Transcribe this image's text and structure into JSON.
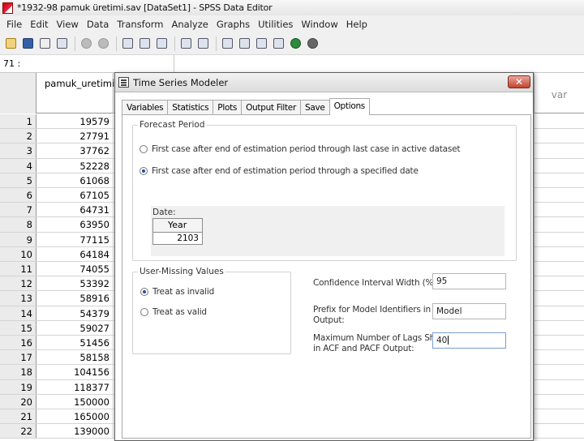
{
  "window": {
    "title": "*1932-98 pamuk üretimi.sav [DataSet1] - SPSS Data Editor"
  },
  "menubar": [
    "File",
    "Edit",
    "View",
    "Data",
    "Transform",
    "Analyze",
    "Graphs",
    "Utilities",
    "Window",
    "Help"
  ],
  "toolbar": {
    "icons": [
      "open-file-icon",
      "save-icon",
      "print-icon",
      "dialog-recall-icon",
      "undo-icon",
      "redo-icon",
      "goto-case-icon",
      "variables-icon",
      "find-icon",
      "insert-cases-icon",
      "insert-variable-icon",
      "split-file-icon",
      "weight-cases-icon",
      "select-cases-icon",
      "value-labels-icon",
      "use-sets-icon",
      "show-all-variables-icon"
    ]
  },
  "cell_bar": {
    "reference": "71 :"
  },
  "grid": {
    "column_header": "pamuk_uretimi",
    "right_column_header": "var",
    "rows": [
      {
        "num": "1",
        "value": "19579"
      },
      {
        "num": "2",
        "value": "27791"
      },
      {
        "num": "3",
        "value": "37762"
      },
      {
        "num": "4",
        "value": "52228"
      },
      {
        "num": "5",
        "value": "61068"
      },
      {
        "num": "6",
        "value": "67105"
      },
      {
        "num": "7",
        "value": "64731"
      },
      {
        "num": "8",
        "value": "63950"
      },
      {
        "num": "9",
        "value": "77115"
      },
      {
        "num": "10",
        "value": "64184"
      },
      {
        "num": "11",
        "value": "74055"
      },
      {
        "num": "12",
        "value": "53392"
      },
      {
        "num": "13",
        "value": "58916"
      },
      {
        "num": "14",
        "value": "54379"
      },
      {
        "num": "15",
        "value": "59027"
      },
      {
        "num": "16",
        "value": "51456"
      },
      {
        "num": "17",
        "value": "58158"
      },
      {
        "num": "18",
        "value": "104156"
      },
      {
        "num": "19",
        "value": "118377"
      },
      {
        "num": "20",
        "value": "150000"
      },
      {
        "num": "21",
        "value": "165000"
      },
      {
        "num": "22",
        "value": "139000"
      }
    ]
  },
  "dialog": {
    "title": "Time Series Modeler",
    "close_label": "✕",
    "tabs": [
      "Variables",
      "Statistics",
      "Plots",
      "Output Filter",
      "Save",
      "Options"
    ],
    "active_tab": "Options",
    "forecast_period": {
      "legend": "Forecast Period",
      "option_first": "First case after end of estimation period through last case in active dataset",
      "option_second": "First case after end of estimation period through a specified date",
      "selected": 1,
      "date_label": "Date:",
      "date_column": "Year",
      "date_value": "2103"
    },
    "user_missing": {
      "legend": "User-Missing Values",
      "option_invalid": "Treat as invalid",
      "option_valid": "Treat as valid",
      "selected": 0
    },
    "confidence": {
      "label": "Confidence Interval Width (%):",
      "value": "95"
    },
    "prefix": {
      "label_line1": "Prefix for Model Identifiers in",
      "label_line2": "Output:",
      "value": "Model"
    },
    "max_lags": {
      "label_line1": "Maximum Number of Lags Shown",
      "label_line2": "in ACF and PACF Output:",
      "value": "40"
    }
  }
}
